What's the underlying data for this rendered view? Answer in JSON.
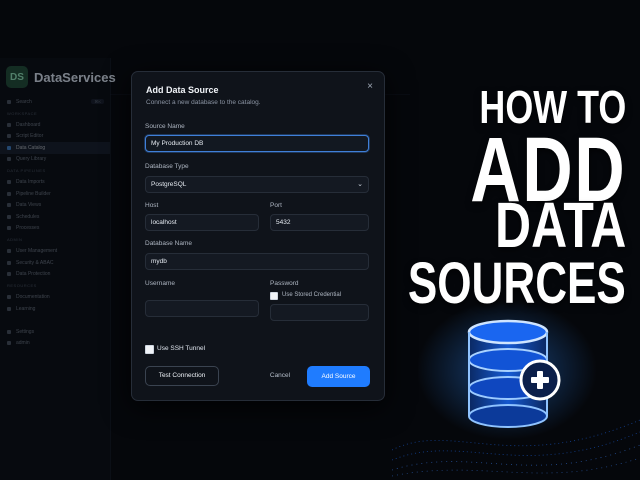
{
  "app": {
    "brand_initials": "DS",
    "brand_name": "DataServices"
  },
  "sidebar": {
    "items": [
      {
        "label": "Search",
        "kind": "row",
        "badge": "⌘K"
      },
      {
        "label": "WORKSPACE",
        "kind": "section"
      },
      {
        "label": "Dashboard",
        "kind": "row"
      },
      {
        "label": "Script Editor",
        "kind": "row"
      },
      {
        "label": "Data Catalog",
        "kind": "row",
        "active": true
      },
      {
        "label": "Query Library",
        "kind": "row"
      },
      {
        "label": "DATA PIPELINES",
        "kind": "section"
      },
      {
        "label": "Data Imports",
        "kind": "row"
      },
      {
        "label": "Pipeline Builder",
        "kind": "row"
      },
      {
        "label": "Data Views",
        "kind": "row"
      },
      {
        "label": "Schedules",
        "kind": "row"
      },
      {
        "label": "Processes",
        "kind": "row"
      },
      {
        "label": "ADMIN",
        "kind": "section"
      },
      {
        "label": "User Management",
        "kind": "row"
      },
      {
        "label": "Security & ABAC",
        "kind": "row"
      },
      {
        "label": "Data Protection",
        "kind": "row"
      },
      {
        "label": "RESOURCES",
        "kind": "section"
      },
      {
        "label": "Documentation",
        "kind": "row"
      },
      {
        "label": "Learning",
        "kind": "row"
      },
      {
        "label": "",
        "kind": "spacer"
      },
      {
        "label": "Settings",
        "kind": "row"
      },
      {
        "label": "admin",
        "kind": "row"
      }
    ]
  },
  "modal": {
    "title": "Add Data Source",
    "subtitle": "Connect a new database to the catalog.",
    "close_icon": "×",
    "source_name": {
      "label": "Source Name",
      "value": "My Production DB"
    },
    "database_type": {
      "label": "Database Type",
      "value": "PostgreSQL",
      "chevron": "⌄"
    },
    "host": {
      "label": "Host",
      "value": "localhost"
    },
    "port": {
      "label": "Port",
      "value": "5432"
    },
    "database_name": {
      "label": "Database Name",
      "value": "mydb"
    },
    "username": {
      "label": "Username",
      "value": ""
    },
    "password": {
      "label": "Password",
      "value": "",
      "stored_credential_label": "Use Stored Credential",
      "stored_credential_checked": false
    },
    "ssh": {
      "label": "Use SSH Tunnel",
      "checked": false
    },
    "buttons": {
      "test": "Test Connection",
      "cancel": "Cancel",
      "add": "Add Source"
    }
  },
  "headline": {
    "line1": "HOW TO",
    "line2": "ADD",
    "line3": "DATA",
    "line4": "SOURCES",
    "add_icon": "plus-icon"
  },
  "colors": {
    "accent": "#1f7cff",
    "glow": "#2f8bff",
    "background": "#05070b",
    "modal_bg": "#0f131a"
  }
}
